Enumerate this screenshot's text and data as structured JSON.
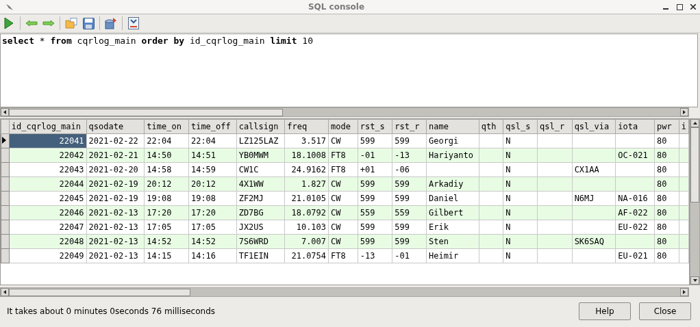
{
  "window": {
    "title": "SQL console"
  },
  "query": "**select** * **from** cqrlog_main **order** **by** id_cqrlog_main **limit** 10",
  "table": {
    "columns": [
      "id_cqrlog_main",
      "qsodate",
      "time_on",
      "time_off",
      "callsign",
      "freq",
      "mode",
      "rst_s",
      "rst_r",
      "name",
      "qth",
      "qsl_s",
      "qsl_r",
      "qsl_via",
      "iota",
      "pwr",
      "i"
    ],
    "rows": [
      {
        "selected": true,
        "cells": [
          "22041",
          "2021-02-22",
          "22:04",
          "22:04",
          "LZ125LAZ",
          "3.517",
          "CW",
          "599",
          "599",
          "Georgi",
          "",
          "N",
          "",
          "",
          "",
          "80",
          ""
        ]
      },
      {
        "selected": false,
        "cells": [
          "22042",
          "2021-02-21",
          "14:50",
          "14:51",
          "YB0MWM",
          "18.1008",
          "FT8",
          "-01",
          "-13",
          "Hariyanto",
          "",
          "N",
          "",
          "",
          "OC-021",
          "80",
          ""
        ]
      },
      {
        "selected": false,
        "cells": [
          "22043",
          "2021-02-20",
          "14:58",
          "14:59",
          "CW1C",
          "24.9162",
          "FT8",
          "+01",
          "-06",
          "",
          "",
          "N",
          "",
          "CX1AA",
          "",
          "80",
          ""
        ]
      },
      {
        "selected": false,
        "cells": [
          "22044",
          "2021-02-19",
          "20:12",
          "20:12",
          "4X1WW",
          "1.827",
          "CW",
          "599",
          "599",
          "Arkadiy",
          "",
          "N",
          "",
          "",
          "",
          "80",
          ""
        ]
      },
      {
        "selected": false,
        "cells": [
          "22045",
          "2021-02-19",
          "19:08",
          "19:08",
          "ZF2MJ",
          "21.0105",
          "CW",
          "599",
          "599",
          "Daniel",
          "",
          "N",
          "",
          "N6MJ",
          "NA-016",
          "80",
          ""
        ]
      },
      {
        "selected": false,
        "cells": [
          "22046",
          "2021-02-13",
          "17:20",
          "17:20",
          "ZD7BG",
          "18.0792",
          "CW",
          "559",
          "559",
          "Gilbert",
          "",
          "N",
          "",
          "",
          "AF-022",
          "80",
          ""
        ]
      },
      {
        "selected": false,
        "cells": [
          "22047",
          "2021-02-13",
          "17:05",
          "17:05",
          "JX2US",
          "10.103",
          "CW",
          "599",
          "599",
          "Erik",
          "",
          "N",
          "",
          "",
          "EU-022",
          "80",
          ""
        ]
      },
      {
        "selected": false,
        "cells": [
          "22048",
          "2021-02-13",
          "14:52",
          "14:52",
          "7S6WRD",
          "7.007",
          "CW",
          "599",
          "599",
          "Sten",
          "",
          "N",
          "",
          "SK6SAQ",
          "",
          "80",
          ""
        ]
      },
      {
        "selected": false,
        "cells": [
          "22049",
          "2021-02-13",
          "14:15",
          "14:16",
          "TF1EIN",
          "21.0754",
          "FT8",
          "-13",
          "-01",
          "Heimir",
          "",
          "N",
          "",
          "",
          "EU-021",
          "80",
          ""
        ]
      }
    ]
  },
  "status": "It takes about 0 minutes 0seconds 76 milliseconds",
  "buttons": [
    "Help",
    "Close"
  ]
}
